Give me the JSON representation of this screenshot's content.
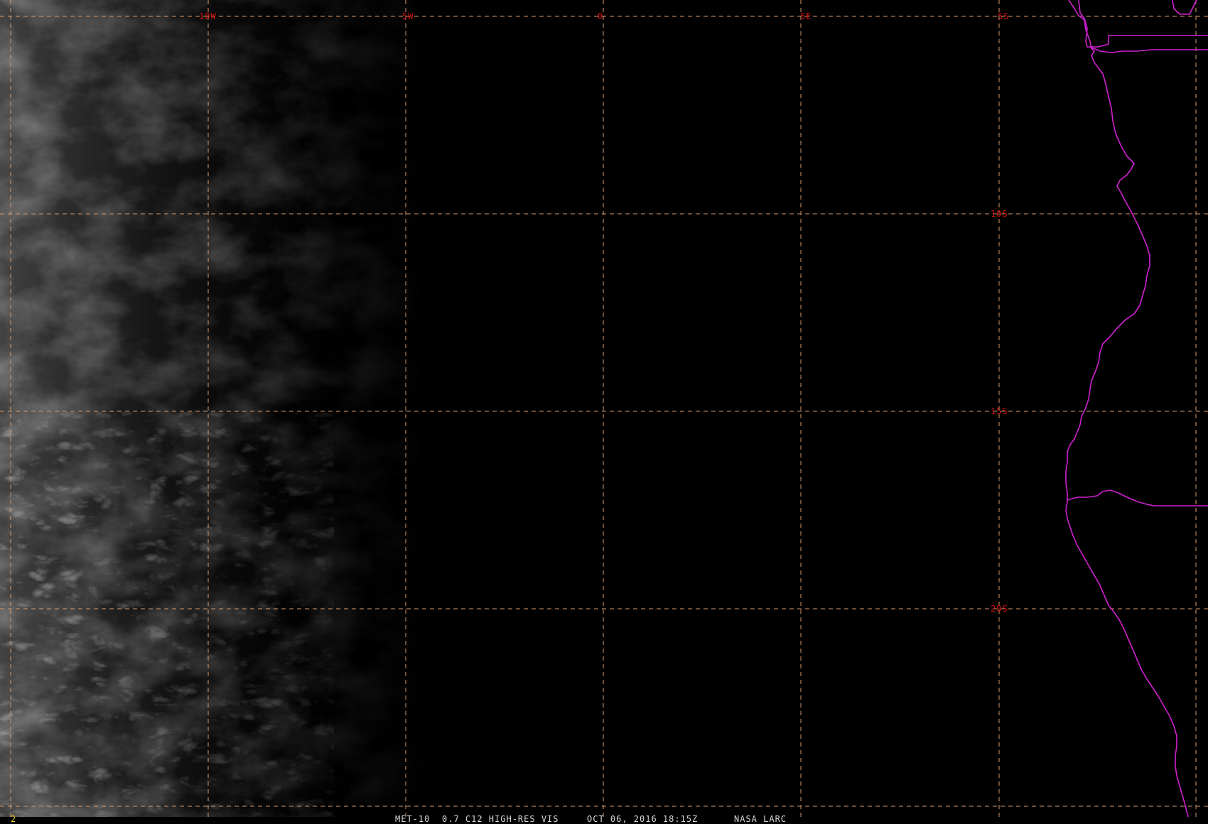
{
  "product": {
    "satellite": "MET-10",
    "channel": "0.7 C12 HIGH-RES VIS",
    "datetime": "OCT 06, 2016 18:15Z",
    "source": "NASA LARC",
    "frame_number": "2"
  },
  "grid": {
    "longitude_labels": [
      "10W",
      "5W",
      "0",
      "5E"
    ],
    "latitude_labels": [
      "5S",
      "10S",
      "15S",
      "20S"
    ],
    "label_color": "#d01010",
    "line_color": "#d79a6a"
  },
  "coastline": {
    "color": "#d020d0"
  },
  "colors": {
    "background": "#000000",
    "cloud": "#8a8a8a",
    "frame_number": "#e8d020",
    "footer_text": "#d8d8d8"
  }
}
